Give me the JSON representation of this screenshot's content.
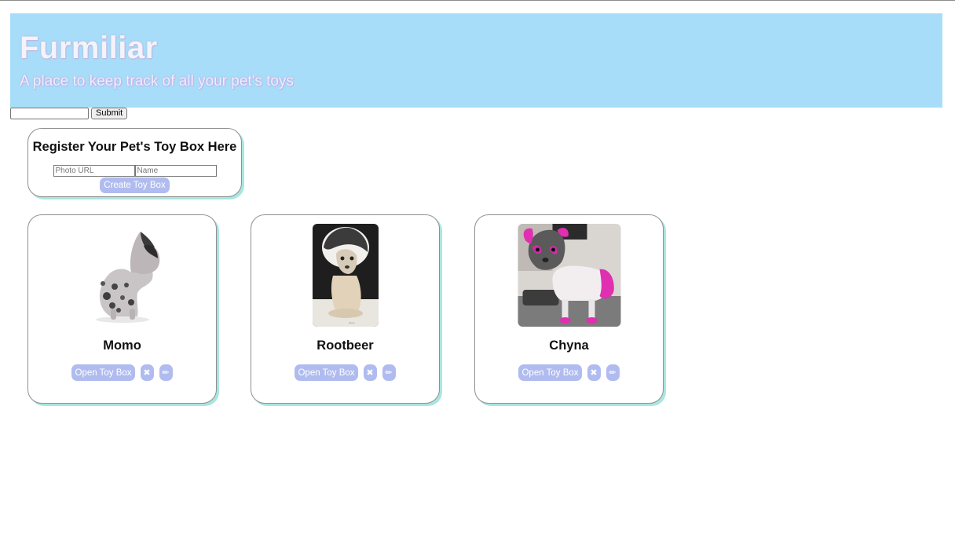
{
  "header": {
    "title": "Furmiliar",
    "subtitle": "A place to keep track of all your pet's toys"
  },
  "search": {
    "value": "",
    "submit_label": "Submit"
  },
  "register": {
    "title": "Register Your Pet's Toy Box Here",
    "photo_placeholder": "Photo URL",
    "name_placeholder": "Name",
    "create_label": "Create Toy Box"
  },
  "pets": [
    {
      "name": "Momo",
      "open_label": "Open Toy Box",
      "delete_icon": "✖",
      "edit_icon": "✏"
    },
    {
      "name": "Rootbeer",
      "open_label": "Open Toy Box",
      "delete_icon": "✖",
      "edit_icon": "✏"
    },
    {
      "name": "Chyna",
      "open_label": "Open Toy Box",
      "delete_icon": "✖",
      "edit_icon": "✏"
    }
  ],
  "colors": {
    "header_bg": "#a7ddf9",
    "button_bg": "#b0bcef",
    "card_shadow": "#a9e6e1"
  },
  "icons": {
    "delete": "close-icon",
    "edit": "pencil-icon"
  }
}
